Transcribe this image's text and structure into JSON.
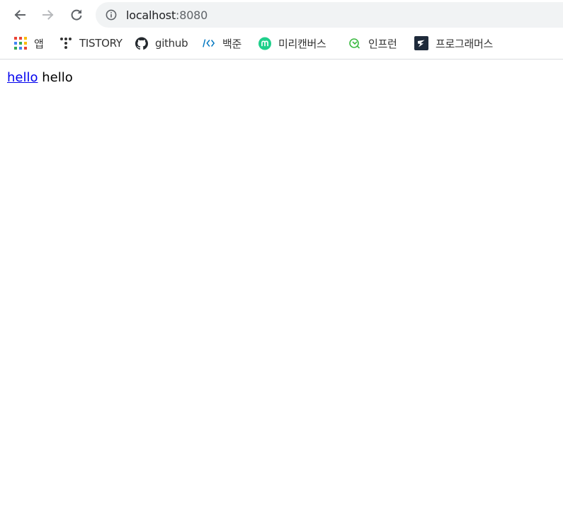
{
  "address_bar": {
    "host": "localhost",
    "port": ":8080"
  },
  "bookmarks": [
    {
      "label": "앱",
      "icon": "apps-grid-icon"
    },
    {
      "label": "TISTORY",
      "icon": "tistory-icon"
    },
    {
      "label": "github",
      "icon": "github-icon"
    },
    {
      "label": "백준",
      "icon": "baekjoon-icon"
    },
    {
      "label": "미리캔버스",
      "icon": "miricanvas-icon"
    },
    {
      "label": "인프런",
      "icon": "inflearn-icon"
    },
    {
      "label": "프로그래머스",
      "icon": "programmers-icon"
    }
  ],
  "page": {
    "link_text": "hello",
    "text": "hello"
  },
  "colors": {
    "link": "#0000ee",
    "toolbar_icon": "#5f6368",
    "omnibox_bg": "#f1f3f4",
    "miricanvas": "#1fcf8b",
    "inflearn": "#3dba43",
    "programmers": "#1e2a3a"
  }
}
